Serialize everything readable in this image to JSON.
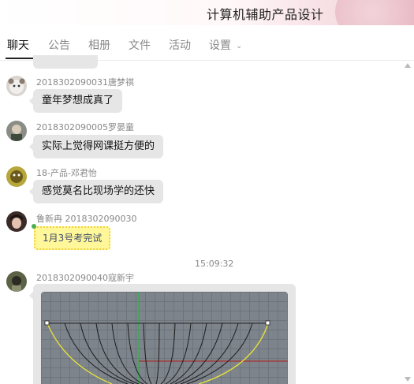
{
  "app": {
    "title": "计算机辅助产品设计"
  },
  "tabs": [
    {
      "label": "聊天",
      "active": true
    },
    {
      "label": "公告",
      "active": false
    },
    {
      "label": "相册",
      "active": false
    },
    {
      "label": "文件",
      "active": false
    },
    {
      "label": "活动",
      "active": false
    },
    {
      "label": "设置",
      "active": false,
      "has_dropdown": true
    }
  ],
  "messages": [
    {
      "sender": "2018302090031唐梦祺",
      "text": "童年梦想成真了"
    },
    {
      "sender": "2018302090005罗晏童",
      "text": "实际上觉得网课挺方便的"
    },
    {
      "sender": "18-产品-邓君怡",
      "text": "感觉莫名比现场学的还快"
    },
    {
      "sender": "鲁新冉 2018302090030",
      "text": "1月3号考完试",
      "style": "note"
    }
  ],
  "timestamp": "15:09:32",
  "image_message": {
    "sender": "2018302090040寇新宇",
    "content": "cad-curves-screenshot"
  },
  "colors": {
    "accent": "#222222",
    "bubble": "#e6e6e6",
    "note_bg": "#fff79a",
    "note_text": "#3d4b6e",
    "cad_bg": "#7e848c"
  },
  "icons": {
    "settings_dropdown": "chevron-down-icon"
  }
}
